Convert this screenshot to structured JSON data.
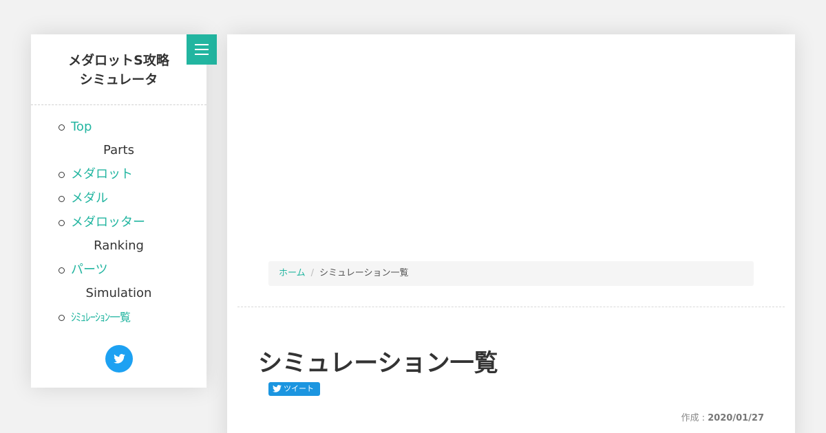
{
  "sidebar": {
    "title_line1": "メダロットS攻略",
    "title_line2": "シミュレータ",
    "nav": {
      "top": "Top",
      "parts_header": "Parts",
      "medarot": "メダロット",
      "medal": "メダル",
      "medarotter": "メダロッター",
      "ranking_header": "Ranking",
      "parts": "パーツ",
      "simulation_header": "Simulation",
      "simulation_list": "ｼﾐｭﾚｰｼｮﾝ一覧"
    }
  },
  "breadcrumb": {
    "home": "ホーム",
    "separator": "/",
    "current": "シミュレーション一覧"
  },
  "page": {
    "title": "シミュレーション一覧",
    "tweet_label": "ツイート",
    "created_label": "作成 :",
    "created_date": "2020/01/27"
  },
  "colors": {
    "accent": "#22b5a0",
    "twitter": "#1da1f2"
  },
  "icons": {
    "menu": "hamburger-menu-icon",
    "twitter": "twitter-bird-icon"
  }
}
